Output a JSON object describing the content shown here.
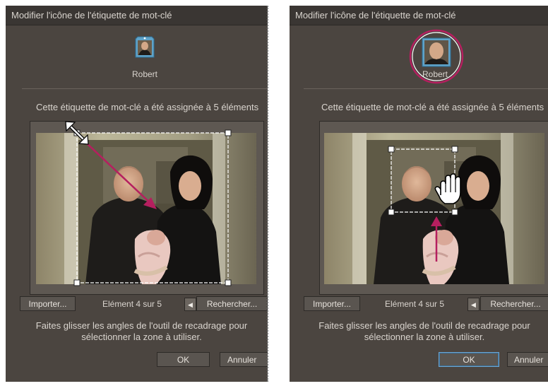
{
  "dialog": {
    "title": "Modifier l'icône de l'étiquette de mot-clé",
    "tag_name": "Robert",
    "assigned_text": "Cette étiquette de mot-clé a été assignée à 5 éléments",
    "import_label": "Importer...",
    "counter_text": "Elément 4 sur 5",
    "prev_arrow": "◀",
    "search_label": "Rechercher...",
    "instructions_line1": "Faites glisser les angles de l'outil de recadrage pour",
    "instructions_line2": "sélectionner la zone à utiliser.",
    "ok_label": "OK",
    "cancel_label": "Annuler"
  },
  "colors": {
    "dialog_bg": "#4b4540",
    "title_bg": "#3a3633",
    "annotation": "#b51f5f"
  },
  "icons": [
    "tag-photo-icon",
    "resize-handle-icon",
    "hand-cursor-icon",
    "arrow-annotation",
    "prev-arrow-icon"
  ]
}
